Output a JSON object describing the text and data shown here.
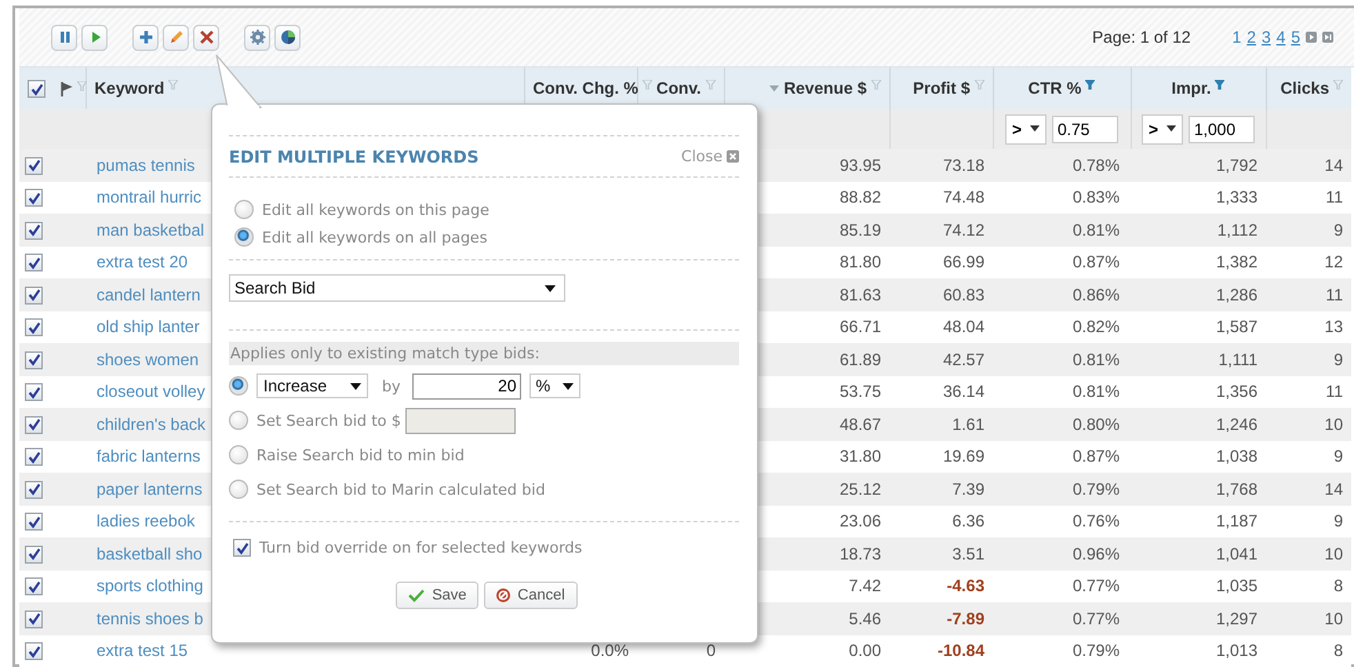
{
  "toolbar": {
    "groups": [
      [
        {
          "kind": "pause"
        },
        {
          "kind": "play"
        }
      ],
      [
        {
          "kind": "add"
        },
        {
          "kind": "edit"
        },
        {
          "kind": "delete"
        }
      ],
      [
        {
          "kind": "settings"
        },
        {
          "kind": "chart"
        }
      ]
    ],
    "page_info": "Page: 1 of 12",
    "pages": [
      {
        "label": "1",
        "selected": true
      },
      {
        "label": "2",
        "selected": false
      },
      {
        "label": "3",
        "selected": false
      },
      {
        "label": "4",
        "selected": false
      },
      {
        "label": "5",
        "selected": false
      }
    ]
  },
  "table": {
    "all_checked": true,
    "columns": [
      {
        "label": "Keyword",
        "filter_active": false,
        "sorted": false
      },
      {
        "label": "Conv. Chg. %",
        "filter_active": false,
        "sorted": false
      },
      {
        "label": "Conv.",
        "filter_active": false,
        "sorted": false
      },
      {
        "label": "Revenue $",
        "filter_active": false,
        "sorted": true
      },
      {
        "label": "Profit $",
        "filter_active": false,
        "sorted": false
      },
      {
        "label": "CTR %",
        "filter_active": true,
        "sorted": false,
        "filter": {
          "operator": ">",
          "value": "0.75"
        }
      },
      {
        "label": "Impr.",
        "filter_active": true,
        "sorted": false,
        "filter": {
          "operator": ">",
          "value": "1,000"
        }
      },
      {
        "label": "Clicks",
        "filter_active": false,
        "sorted": false
      }
    ],
    "rows": [
      {
        "checked": true,
        "keyword": "pumas tennis",
        "revenue": "93.95",
        "profit": "73.18",
        "loss": false,
        "ctr": "0.78%",
        "impr": "1,792",
        "clicks": "14"
      },
      {
        "checked": true,
        "keyword": "montrail hurric",
        "revenue": "88.82",
        "profit": "74.48",
        "loss": false,
        "ctr": "0.83%",
        "impr": "1,333",
        "clicks": "11"
      },
      {
        "checked": true,
        "keyword": "man basketbal",
        "revenue": "85.19",
        "profit": "74.12",
        "loss": false,
        "ctr": "0.81%",
        "impr": "1,112",
        "clicks": "9"
      },
      {
        "checked": true,
        "keyword": "extra test 20",
        "revenue": "81.80",
        "profit": "66.99",
        "loss": false,
        "ctr": "0.87%",
        "impr": "1,382",
        "clicks": "12"
      },
      {
        "checked": true,
        "keyword": "candel lantern",
        "revenue": "81.63",
        "profit": "60.83",
        "loss": false,
        "ctr": "0.86%",
        "impr": "1,286",
        "clicks": "11"
      },
      {
        "checked": true,
        "keyword": "old ship lanter",
        "revenue": "66.71",
        "profit": "48.04",
        "loss": false,
        "ctr": "0.82%",
        "impr": "1,587",
        "clicks": "13"
      },
      {
        "checked": true,
        "keyword": "shoes women",
        "revenue": "61.89",
        "profit": "42.57",
        "loss": false,
        "ctr": "0.81%",
        "impr": "1,111",
        "clicks": "9"
      },
      {
        "checked": true,
        "keyword": "closeout volley",
        "revenue": "53.75",
        "profit": "36.14",
        "loss": false,
        "ctr": "0.81%",
        "impr": "1,356",
        "clicks": "11"
      },
      {
        "checked": true,
        "keyword": "children's back",
        "revenue": "48.67",
        "profit": "1.61",
        "loss": false,
        "ctr": "0.80%",
        "impr": "1,246",
        "clicks": "10"
      },
      {
        "checked": true,
        "keyword": "fabric lanterns",
        "revenue": "31.80",
        "profit": "19.69",
        "loss": false,
        "ctr": "0.87%",
        "impr": "1,038",
        "clicks": "9"
      },
      {
        "checked": true,
        "keyword": "paper lanterns",
        "revenue": "25.12",
        "profit": "7.39",
        "loss": false,
        "ctr": "0.79%",
        "impr": "1,768",
        "clicks": "14"
      },
      {
        "checked": true,
        "keyword": "ladies reebok",
        "revenue": "23.06",
        "profit": "6.36",
        "loss": false,
        "ctr": "0.76%",
        "impr": "1,187",
        "clicks": "9"
      },
      {
        "checked": true,
        "keyword": "basketball sho",
        "revenue": "18.73",
        "profit": "3.51",
        "loss": false,
        "ctr": "0.96%",
        "impr": "1,041",
        "clicks": "10"
      },
      {
        "checked": true,
        "keyword": "sports clothing",
        "revenue": "7.42",
        "profit": "-4.63",
        "loss": true,
        "ctr": "0.77%",
        "impr": "1,035",
        "clicks": "8"
      },
      {
        "checked": true,
        "keyword": "tennis shoes b",
        "revenue": "5.46",
        "profit": "-7.89",
        "loss": true,
        "ctr": "0.77%",
        "impr": "1,297",
        "clicks": "10"
      },
      {
        "checked": true,
        "keyword": "extra test 15",
        "conv_chg": "0.0%",
        "conv": "0",
        "revenue": "0.00",
        "profit": "-10.84",
        "loss": true,
        "ctr": "0.79%",
        "impr": "1,013",
        "clicks": "8"
      }
    ]
  },
  "popup": {
    "title": "EDIT MULTIPLE KEYWORDS",
    "close": "Close",
    "scope": [
      {
        "label": "Edit all keywords on this page",
        "selected": false
      },
      {
        "label": "Edit all keywords on all pages",
        "selected": true
      }
    ],
    "field": "Search Bid",
    "section": "Applies only to existing match type bids:",
    "options": [
      {
        "kind": "adjust",
        "selected": true,
        "action": "Increase",
        "by": "by",
        "amount": "20",
        "unit": "%"
      },
      {
        "kind": "set",
        "selected": false,
        "label": "Set Search bid to $"
      },
      {
        "kind": "plain",
        "selected": false,
        "label": "Raise Search bid to min bid"
      },
      {
        "kind": "plain",
        "selected": false,
        "label": "Set Search bid to Marin calculated bid"
      }
    ],
    "override": {
      "label": "Turn bid override on for selected keywords",
      "checked": true
    },
    "buttons": [
      {
        "kind": "save",
        "label": "Save"
      },
      {
        "kind": "cancel",
        "label": "Cancel"
      }
    ]
  }
}
